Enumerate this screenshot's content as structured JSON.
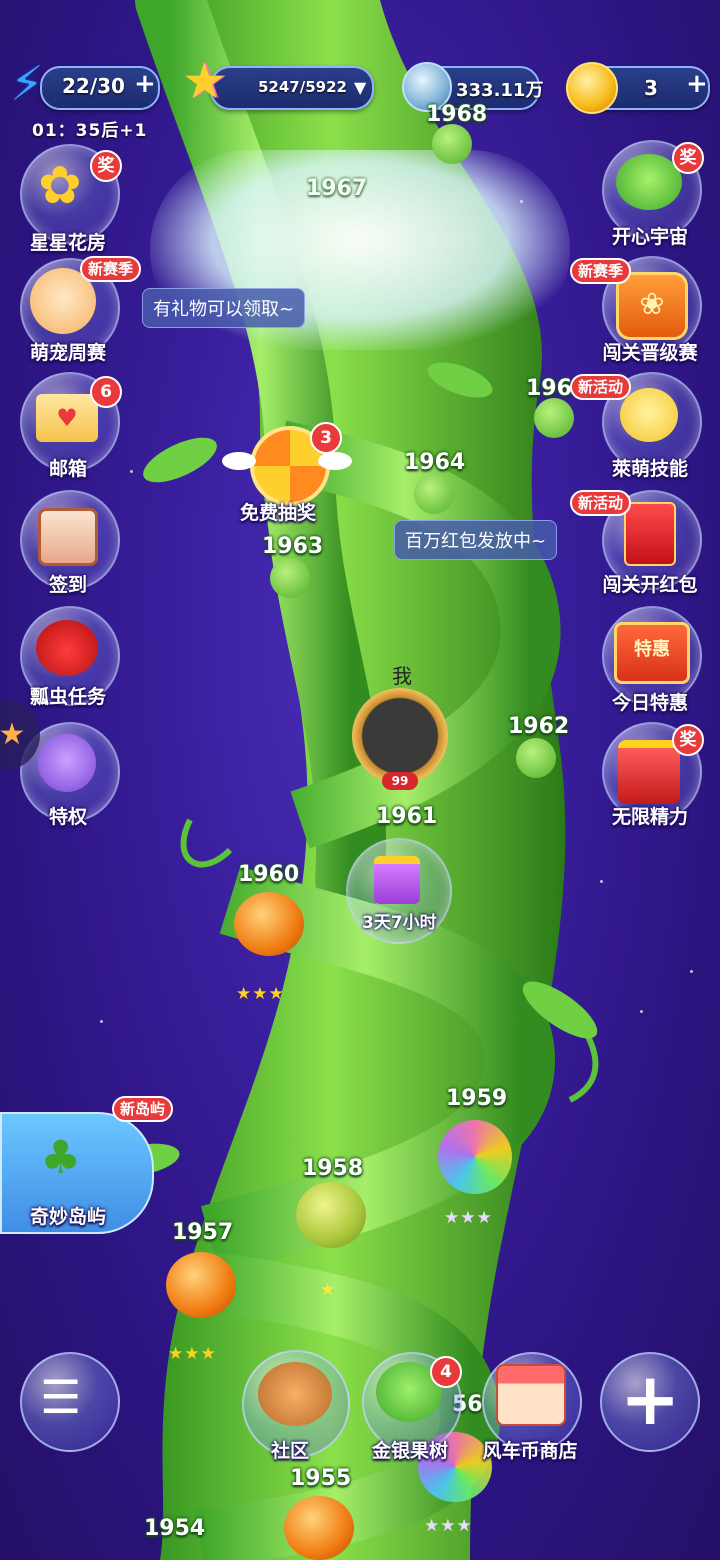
{
  "top_bar": {
    "energy": {
      "value": "22/30",
      "timer": "01：35后+1"
    },
    "stars": {
      "value": "5247/5922"
    },
    "currency": {
      "value": "333.11万"
    },
    "coins": {
      "value": "3"
    }
  },
  "left_menu": [
    {
      "label": "星星花房",
      "badge": "奖",
      "icon": "flower-pot-icon"
    },
    {
      "label": "萌宠周赛",
      "badge": "新赛季",
      "icon": "cat-icon"
    },
    {
      "label": "邮箱",
      "badge": "6",
      "icon": "envelope-icon"
    },
    {
      "label": "签到",
      "badge": "",
      "icon": "calendar-icon"
    },
    {
      "label": "瓢虫任务",
      "badge": "",
      "icon": "ladybug-icon"
    },
    {
      "label": "特权",
      "badge": "",
      "icon": "owl-icon"
    }
  ],
  "right_menu": [
    {
      "label": "开心宇宙",
      "badge": "奖",
      "icon": "frog-icon"
    },
    {
      "label": "闯关晋级赛",
      "badge": "新赛季",
      "icon": "badge-icon"
    },
    {
      "label": "萊萌技能",
      "badge": "新活动",
      "icon": "chick-icon"
    },
    {
      "label": "闯关开红包",
      "badge": "新活动",
      "icon": "red-envelope-icon"
    },
    {
      "label": "今日特惠",
      "badge": "",
      "tag": "特惠",
      "icon": "shop-stall-icon"
    },
    {
      "label": "无限精力",
      "badge": "奖",
      "icon": "gift-drink-icon"
    }
  ],
  "tooltips": {
    "gift": "有礼物可以领取~",
    "red_packet": "百万红包发放中~"
  },
  "lottery": {
    "label": "免费抽奖",
    "count": "3"
  },
  "player": {
    "name": "我",
    "level": "99"
  },
  "gift_timer": "3天7小时",
  "island": {
    "label": "奇妙岛屿",
    "badge": "新岛屿"
  },
  "levels": [
    "1968",
    "1967",
    "196",
    "1964",
    "1963",
    "1962",
    "1961",
    "1960",
    "1959",
    "1958",
    "1957",
    "56",
    "1955",
    "1954"
  ],
  "bottom_bar": [
    {
      "label": "",
      "icon": "menu-list-icon"
    },
    {
      "label": "社区",
      "icon": "community-icon"
    },
    {
      "label": "金银果树",
      "icon": "fruit-tree-icon",
      "badge": "4"
    },
    {
      "label": "风车币商店",
      "icon": "shop-icon"
    },
    {
      "label": "",
      "icon": "plus-icon"
    }
  ]
}
